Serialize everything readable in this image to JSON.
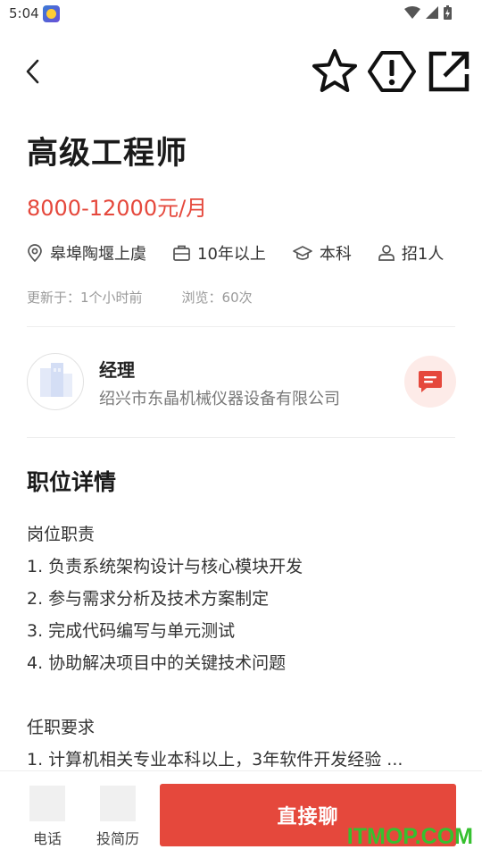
{
  "status_bar": {
    "time": "5:04",
    "icons": [
      "wifi-icon",
      "signal-icon",
      "battery-icon"
    ]
  },
  "header": {
    "back_icon": "back-arrow-icon",
    "actions": [
      "star-icon",
      "report-icon",
      "share-icon"
    ]
  },
  "job": {
    "title": "高级工程师",
    "salary": "8000-12000元/月",
    "location": "皋埠陶堰上虞",
    "experience": "10年以上",
    "education": "本科",
    "headcount": "招1人",
    "updated": "更新于：1个小时前",
    "views": "浏览：60次"
  },
  "company": {
    "contact_title": "经理",
    "name": "绍兴市东晶机械仪器设备有限公司"
  },
  "details": {
    "section_title": "职位详情",
    "duties_heading": "岗位职责",
    "duties": [
      "1. 负责系统架构设计与核心模块开发",
      "2. 参与需求分析及技术方案制定",
      "3. 完成代码编写与单元测试",
      "4. 协助解决项目中的关键技术问题"
    ],
    "requirements_heading": "任职要求",
    "requirements": [
      "1. 计算机相关专业本科以上，3年软件开发经验 ..."
    ]
  },
  "bottom_bar": {
    "phone_label": "电话",
    "resume_label": "投简历",
    "chat_label": "直接聊"
  },
  "watermark": "ITMOP.COM",
  "colors": {
    "accent": "#e5483c",
    "chat_bg": "#fdebe8",
    "watermark": "#36c02f"
  }
}
